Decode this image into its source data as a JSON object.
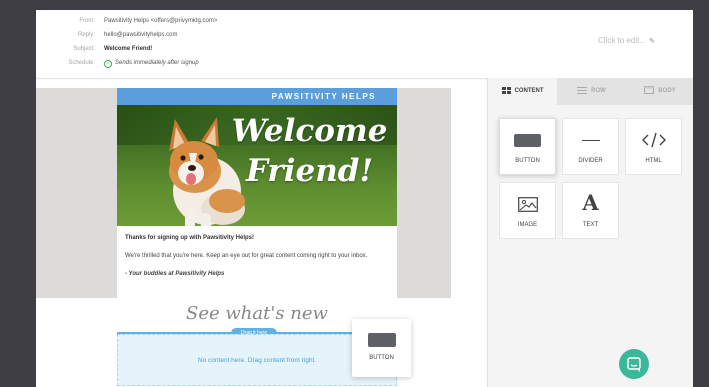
{
  "header": {
    "from_label": "From:",
    "from_value": "Pawsitivity Helps <offers@privymktg.com>",
    "reply_label": "Reply:",
    "reply_value": "hello@pawsitivityhelps.com",
    "subject_label": "Subject:",
    "subject_value": "Welcome Friend!",
    "schedule_label": "Schedule:",
    "schedule_value": "Sends immediately after signup",
    "edit_hint": "Click to edit..."
  },
  "email": {
    "brand": "PAWSITIVITY HELPS",
    "hero_text_line1": "Welcome",
    "hero_text_line2": "Friend!",
    "thanks": "Thanks for signing up with Pawsitivity Helps!",
    "body": "We're thrilled that you're here. Keep an eye out for great content coming right to your inbox.",
    "signoff": "- Your buddies at Pawsitivity Helps",
    "section_title": "See what's new",
    "drag_label": "Drag it here",
    "empty_text": "No content here. Drag content from right."
  },
  "dragging": {
    "label": "BUTTON"
  },
  "panel": {
    "tabs": [
      {
        "label": "CONTENT",
        "active": true
      },
      {
        "label": "ROW",
        "active": false
      },
      {
        "label": "BODY",
        "active": false
      }
    ],
    "tiles": [
      {
        "label": "BUTTON",
        "icon": "button-icon"
      },
      {
        "label": "DIVIDER",
        "icon": "divider-icon"
      },
      {
        "label": "HTML",
        "icon": "code-icon"
      },
      {
        "label": "IMAGE",
        "icon": "image-icon"
      },
      {
        "label": "TEXT",
        "icon": "text-icon",
        "glyph": "A"
      }
    ]
  },
  "colors": {
    "accent": "#5a9fdc",
    "drop_line": "#5fb2e3",
    "chat": "#3bb89a"
  }
}
